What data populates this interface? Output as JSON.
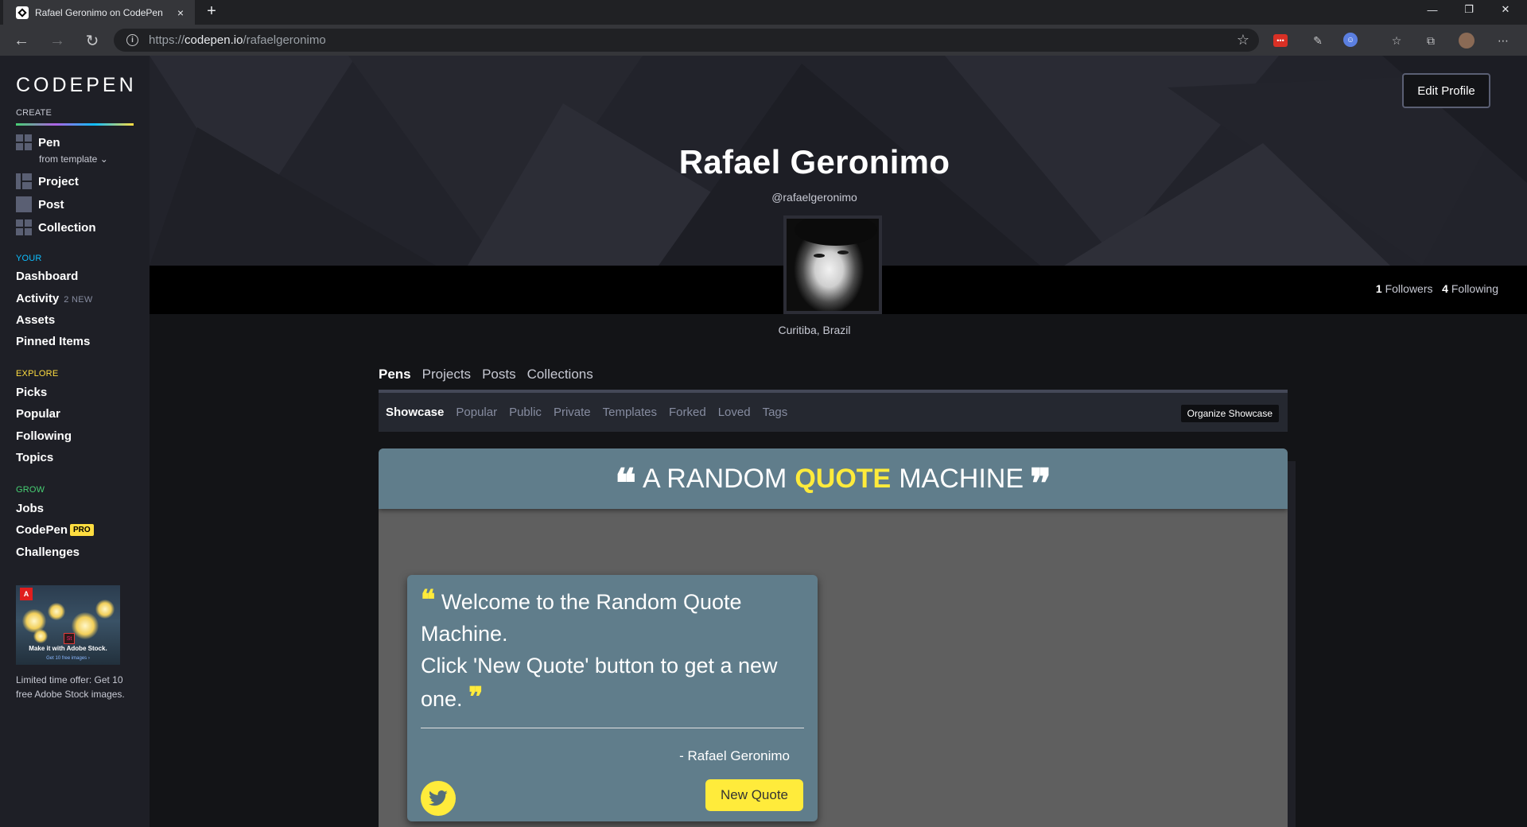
{
  "browser": {
    "tab_title": "Rafael Geronimo on CodePen",
    "tab_close": "×",
    "new_tab": "+",
    "url_scheme": "https://",
    "url_host": "codepen.io",
    "url_path": "/rafaelgeronimo",
    "window_controls": [
      "—",
      "❐",
      "✕"
    ],
    "menu": "⋯"
  },
  "sidebar": {
    "logo": "CODEPEN",
    "create_label": "CREATE",
    "create_items": [
      {
        "label": "Pen",
        "icon": "pen-icon"
      },
      {
        "label": "Project",
        "icon": "project-icon"
      },
      {
        "label": "Post",
        "icon": "post-icon"
      },
      {
        "label": "Collection",
        "icon": "collection-icon"
      }
    ],
    "from_template": "from template",
    "your_label": "YOUR",
    "your_items": [
      "Dashboard",
      "Activity",
      "Assets",
      "Pinned Items"
    ],
    "activity_badge": "2 NEW",
    "explore_label": "EXPLORE",
    "explore_items": [
      "Picks",
      "Popular",
      "Following",
      "Topics"
    ],
    "grow_label": "GROW",
    "grow_items": [
      "Jobs",
      "CodePen",
      "Challenges"
    ],
    "pro_badge": "PRO",
    "ad_tagline": "Make it with Adobe Stock.",
    "ad_cta": "Get 10 free images ›",
    "ad_text": "Limited time offer: Get 10 free Adobe Stock images.",
    "colors": {
      "create": "#c7c9d3",
      "your": "#0ebeff",
      "explore": "#ffdd40",
      "grow": "#47cf73"
    }
  },
  "profile": {
    "edit_button": "Edit Profile",
    "name": "Rafael Geronimo",
    "handle": "@rafaelgeronimo",
    "location": "Curitiba, Brazil",
    "followers_count": "1",
    "followers_label": "Followers",
    "following_count": "4",
    "following_label": "Following"
  },
  "tabs": [
    "Pens",
    "Projects",
    "Posts",
    "Collections"
  ],
  "subnav": {
    "items": [
      "Showcase",
      "Popular",
      "Public",
      "Private",
      "Templates",
      "Forked",
      "Loved",
      "Tags"
    ],
    "organize_button": "Organize Showcase"
  },
  "preview": {
    "title_before": "A RANDOM",
    "title_accent": "QUOTE",
    "title_after": "MACHINE",
    "quote_line1": "Welcome to the Random Quote",
    "quote_line2": "Machine.",
    "quote_line3": "Click 'New Quote' button to get a new",
    "quote_line4": "one.",
    "author": "- Rafael Geronimo",
    "new_quote_button": "New Quote",
    "accent_color": "#ffeb3b",
    "bg_color": "#607d8b"
  }
}
